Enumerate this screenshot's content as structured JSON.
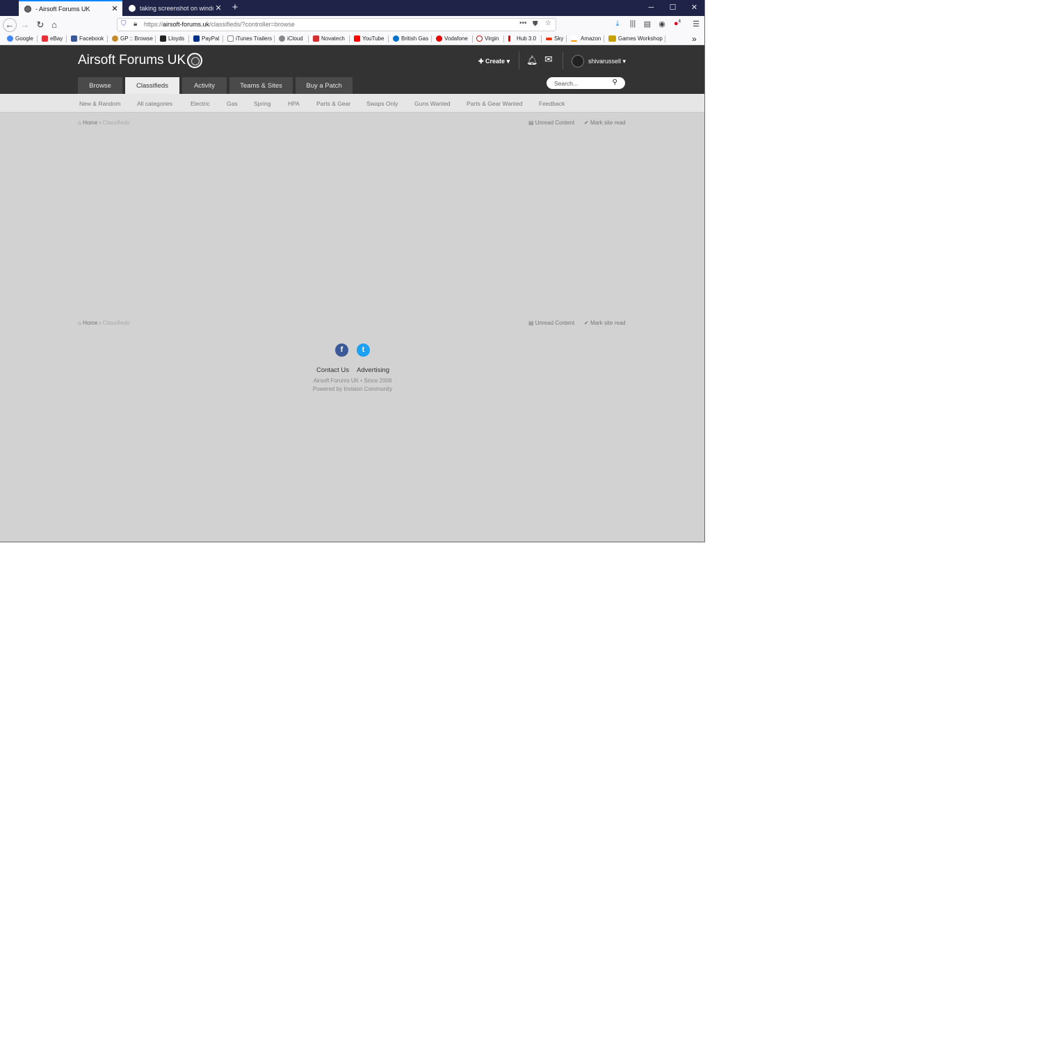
{
  "browser": {
    "tabs": [
      {
        "title": "- Airsoft Forums UK",
        "active": true
      },
      {
        "title": "taking screenshot on windows",
        "active": false
      }
    ],
    "new_tab": "+",
    "window_controls": {
      "minimize": "─",
      "maximize": "☐",
      "close": "✕"
    },
    "url": {
      "scheme": "https://",
      "host": "airsoft-forums.uk",
      "path": "/classifieds/?controller=browse"
    },
    "addon_badge": "4",
    "bookmarks": [
      "Google",
      "eBay",
      "Facebook",
      "GP :: Browse",
      "Lloyds",
      "PayPal",
      "iTunes Trailers",
      "iCloud",
      "Novatech",
      "YouTube",
      "British Gas",
      "Vodafone",
      "Virgin",
      "Hub 3.0",
      "Sky",
      "Amazon",
      "Games Workshop"
    ],
    "bookmark_more": "»"
  },
  "site": {
    "logo_text": "Airsoft Forums UK",
    "create_label": "Create",
    "username": "shivarussell",
    "nav_tabs": [
      "Browse",
      "Classifieds",
      "Activity",
      "Teams & Sites",
      "Buy a Patch"
    ],
    "active_tab": "Classifieds",
    "search_placeholder": "Search...",
    "sub_nav": [
      "New & Random",
      "All categories",
      "Electric",
      "Gas",
      "Spring",
      "HPA",
      "Parts & Gear",
      "Swaps Only",
      "Guns Wanted",
      "Parts & Gear Wanted",
      "Feedback"
    ],
    "breadcrumb": {
      "home": "Home",
      "current": "Classifieds"
    },
    "unread_content": "Unread Content",
    "mark_site_read": "Mark site read"
  },
  "footer": {
    "links": [
      "Contact Us",
      "Advertising"
    ],
    "copyright": "Airsoft Forums UK • Since 2008",
    "powered_by": "Powered by Invision Community"
  },
  "colors": {
    "titlebar": "#1f2347",
    "site_header": "#333333",
    "page_bg": "#d2d2d2",
    "facebook": "#3b5998",
    "twitter": "#1da1f2"
  }
}
